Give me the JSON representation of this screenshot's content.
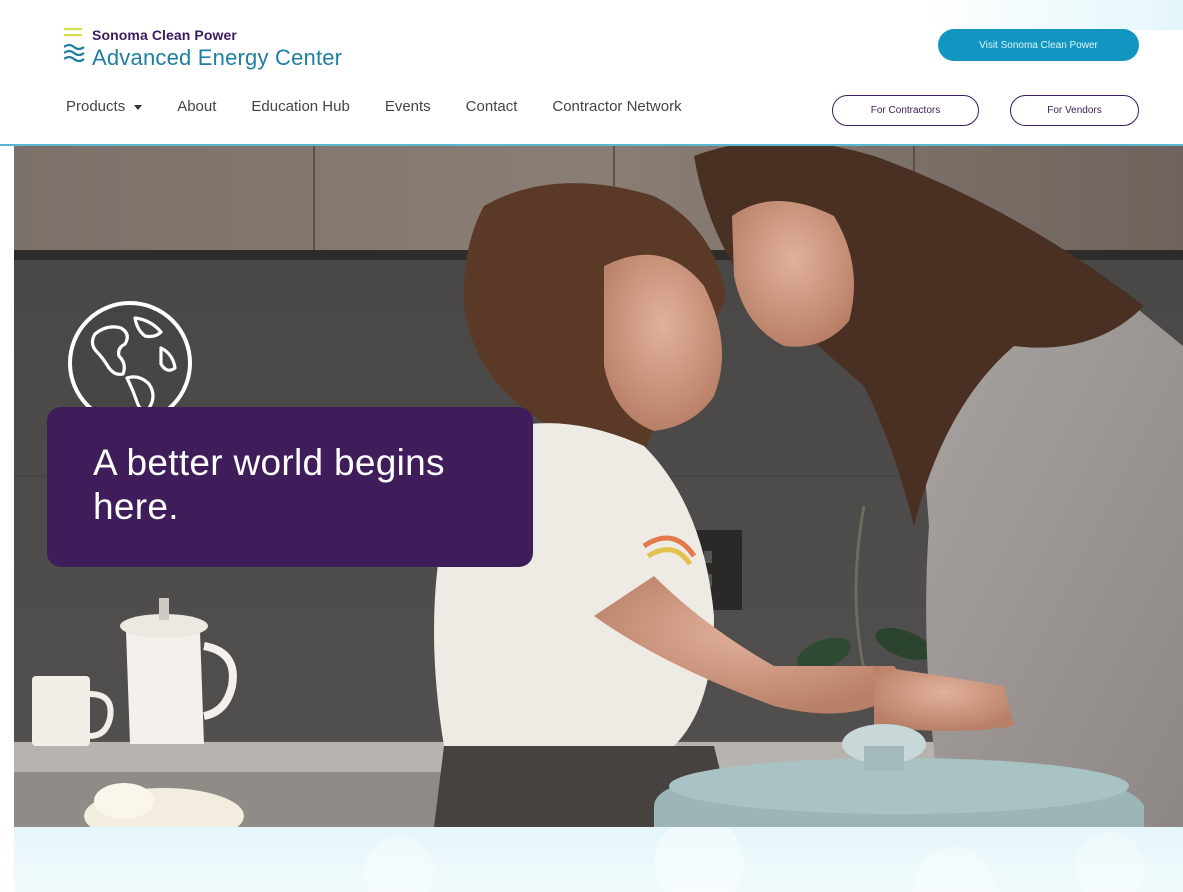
{
  "brand": {
    "top": "Sonoma Clean Power",
    "bottom": "Advanced Energy Center",
    "logo_icon": "wave-lines-icon"
  },
  "header": {
    "visit_button": "Visit Sonoma Clean Power",
    "for_contractors": "For Contractors",
    "for_vendors": "For Vendors"
  },
  "nav": {
    "items": [
      "Products",
      "About",
      "Education Hub",
      "Events",
      "Contact",
      "Contractor Network"
    ]
  },
  "hero": {
    "headline": "A better world begins here.",
    "icon": "globe-icon"
  },
  "colors": {
    "purple": "#3e1d5a",
    "teal": "#1296c1",
    "accent_line": "#59b7d1",
    "lime": "#d5e049"
  }
}
